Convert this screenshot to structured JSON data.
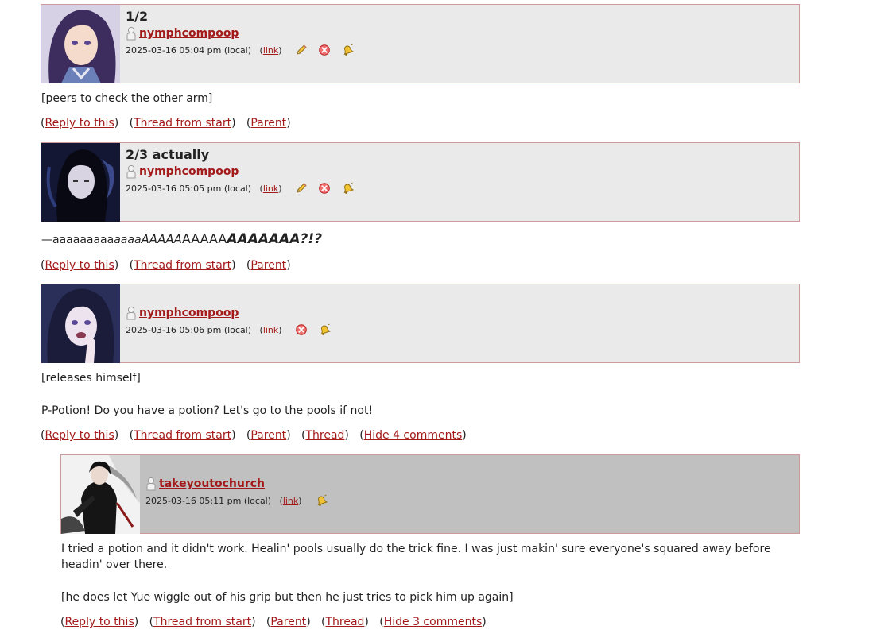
{
  "comments": [
    {
      "subject": "1/2",
      "username": "nymphcompoop",
      "date": "2025-03-16 05:04 pm (local)",
      "link_label": "link",
      "icons": [
        "edit-pencil-icon",
        "delete-x-icon",
        "track-bell-icon"
      ],
      "body": [
        "[peers to check the other arm]"
      ],
      "links": {
        "reply": "Reply to this",
        "thread_start": "Thread from start",
        "parent": "Parent"
      }
    },
    {
      "subject": "2/3 actually",
      "username": "nymphcompoop",
      "date": "2025-03-16 05:05 pm (local)",
      "link_label": "link",
      "icons": [
        "edit-pencil-icon",
        "delete-x-icon",
        "track-bell-icon"
      ],
      "body_scream": [
        "—aaaaaaaaa",
        "aaaa",
        "AAAAA",
        "AAAAA",
        "AAAAAAA?!?"
      ],
      "links": {
        "reply": "Reply to this",
        "thread_start": "Thread from start",
        "parent": "Parent"
      }
    },
    {
      "subject": "",
      "username": "nymphcompoop",
      "date": "2025-03-16 05:06 pm (local)",
      "link_label": "link",
      "icons": [
        "delete-x-icon",
        "track-bell-icon"
      ],
      "body": [
        "[releases himself]",
        "P-Potion! Do you have a potion? Let's go to the pools if not!"
      ],
      "links": {
        "reply": "Reply to this",
        "thread_start": "Thread from start",
        "parent": "Parent",
        "thread": "Thread",
        "hide": "Hide 4 comments"
      }
    },
    {
      "subject": "",
      "username": "takeyoutochurch",
      "date": "2025-03-16 05:11 pm (local)",
      "link_label": "link",
      "icons": [
        "track-bell-icon"
      ],
      "body": [
        "I tried a potion and it didn't work. Healin' pools usually do the trick fine. I was just makin' sure everyone's squared away before headin' over there.",
        "[he does let Yue wiggle out of his grip but then he just tries to pick him up again]"
      ],
      "links": {
        "reply": "Reply to this",
        "thread_start": "Thread from start",
        "parent": "Parent",
        "thread": "Thread",
        "hide": "Hide 3 comments"
      }
    }
  ],
  "colors": {
    "link": "#a31a1a",
    "header_bg": "#eaeaea",
    "header_bg_dark": "#c0c0c0",
    "header_border": "#cc9a9a"
  }
}
